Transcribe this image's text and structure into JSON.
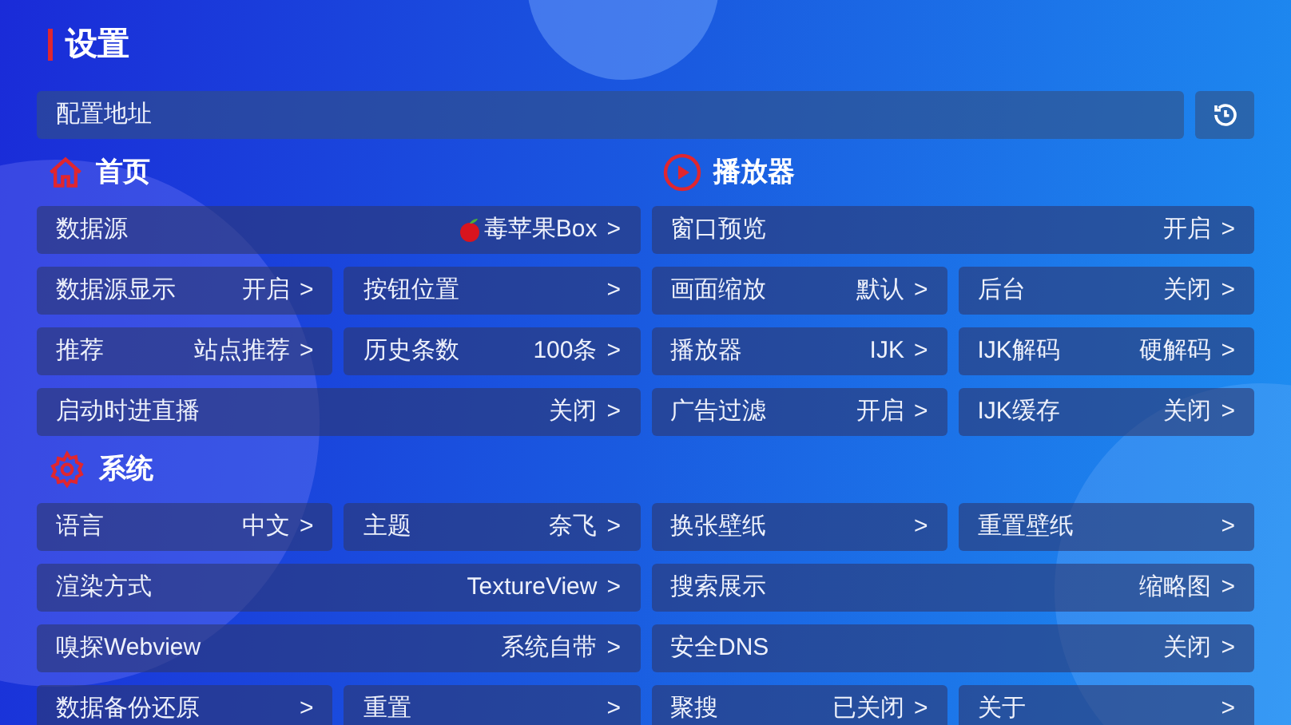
{
  "title": "设置",
  "config": {
    "label": "配置地址"
  },
  "top_sections": [
    {
      "kind": "home",
      "title": "首页",
      "items": [
        {
          "label": "数据源",
          "value": "毒苹果Box",
          "arrow": ">",
          "wide": true,
          "has_icon": true
        },
        {
          "label": "数据源显示",
          "value": "开启",
          "arrow": ">",
          "wide": false,
          "has_icon": false
        },
        {
          "label": "按钮位置",
          "arrow": ">",
          "wide": false,
          "has_icon": false
        },
        {
          "label": "推荐",
          "value": "站点推荐",
          "arrow": ">",
          "wide": false,
          "has_icon": false
        },
        {
          "label": "历史条数",
          "value": "100条",
          "arrow": ">",
          "wide": false,
          "has_icon": false
        },
        {
          "label": "启动时进直播",
          "value": "关闭",
          "arrow": ">",
          "wide": true,
          "has_icon": false
        }
      ]
    },
    {
      "kind": "player",
      "title": "播放器",
      "items": [
        {
          "label": "窗口预览",
          "value": "开启",
          "arrow": ">",
          "wide": true,
          "has_icon": false
        },
        {
          "label": "画面缩放",
          "value": "默认",
          "arrow": ">",
          "wide": false,
          "has_icon": false
        },
        {
          "label": "后台",
          "value": "关闭",
          "arrow": ">",
          "wide": false,
          "has_icon": false
        },
        {
          "label": "播放器",
          "value": "IJK",
          "arrow": ">",
          "wide": false,
          "has_icon": false
        },
        {
          "label": "IJK解码",
          "value": "硬解码",
          "arrow": ">",
          "wide": false,
          "has_icon": false
        },
        {
          "label": "广告过滤",
          "value": "开启",
          "arrow": ">",
          "wide": false,
          "has_icon": false
        },
        {
          "label": "IJK缓存",
          "value": "关闭",
          "arrow": ">",
          "wide": false,
          "has_icon": false
        }
      ]
    }
  ],
  "system": {
    "kind": "system",
    "title": "系统",
    "items": [
      {
        "label": "语言",
        "value": "中文",
        "arrow": ">",
        "wide": false
      },
      {
        "label": "主题",
        "value": "奈飞",
        "arrow": ">",
        "wide": false
      },
      {
        "label": "换张壁纸",
        "arrow": ">",
        "wide": false
      },
      {
        "label": "重置壁纸",
        "arrow": ">",
        "wide": false
      },
      {
        "label": "渲染方式",
        "value": "TextureView",
        "arrow": ">",
        "wide": true
      },
      {
        "label": "搜索展示",
        "value": "缩略图",
        "arrow": ">",
        "wide": true
      },
      {
        "label": "嗅探Webview",
        "value": "系统自带",
        "arrow": ">",
        "wide": true
      },
      {
        "label": "安全DNS",
        "value": "关闭",
        "arrow": ">",
        "wide": true
      },
      {
        "label": "数据备份还原",
        "arrow": ">",
        "wide": false
      },
      {
        "label": "重置",
        "arrow": ">",
        "wide": false
      },
      {
        "label": "聚搜",
        "value": "已关闭",
        "arrow": ">",
        "wide": false
      },
      {
        "label": "关于",
        "arrow": ">",
        "wide": false
      }
    ]
  }
}
